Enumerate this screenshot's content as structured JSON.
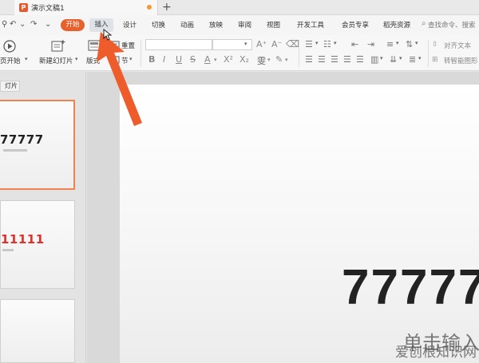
{
  "window": {
    "doc_title": "演示文稿1",
    "new_tab": "+"
  },
  "menu": {
    "items": [
      "开始",
      "插入",
      "设计",
      "切换",
      "动画",
      "放映",
      "审阅",
      "视图",
      "开发工具",
      "会员专享",
      "稻壳资源"
    ],
    "search_placeholder": "查找命令、搜索"
  },
  "ribbon": {
    "play_from_current": "页开始",
    "new_slide": "新建幻灯片",
    "layout": "版式",
    "reset": "重置",
    "section": "节",
    "bold": "B",
    "italic": "I",
    "underline": "U",
    "strike": "S",
    "font_color": "A",
    "superscript": "X²",
    "subscript": "X₂",
    "align_text": "对齐文本",
    "smart_graphic": "转智能图形"
  },
  "left_pane": {
    "tab_label": "灯片",
    "slides": [
      {
        "title": "77777",
        "color": "#222222"
      },
      {
        "title": "11111",
        "color": "#e0302a"
      },
      {
        "title": "",
        "color": "#222222"
      }
    ]
  },
  "slide": {
    "title": "77777",
    "subtitle": "单击输入"
  },
  "watermark": "爱创根知识网"
}
